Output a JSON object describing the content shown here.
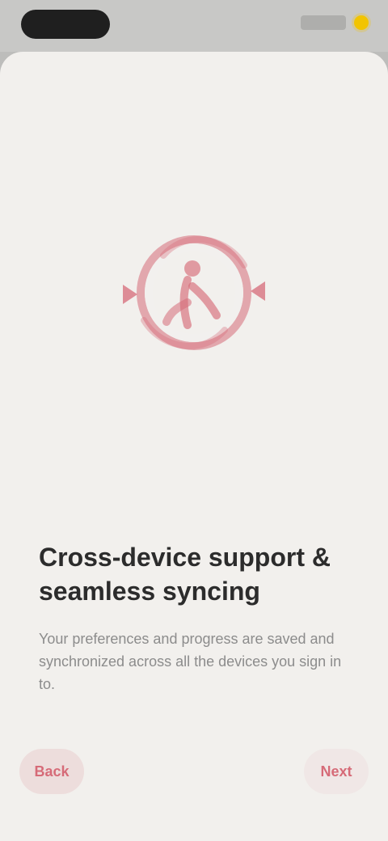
{
  "status_bar": {
    "time": ""
  },
  "onboarding": {
    "icon": "sync-person-icon",
    "title": "Cross-device support & seamless syncing",
    "body": "Your preferences and progress are saved and synchronized across all the devices you sign in to."
  },
  "navigation": {
    "back_label": "Back",
    "next_label": "Next"
  },
  "colors": {
    "accent": "#d66b78",
    "background": "#f2f0ed",
    "status_bar": "#c8c8c6"
  }
}
